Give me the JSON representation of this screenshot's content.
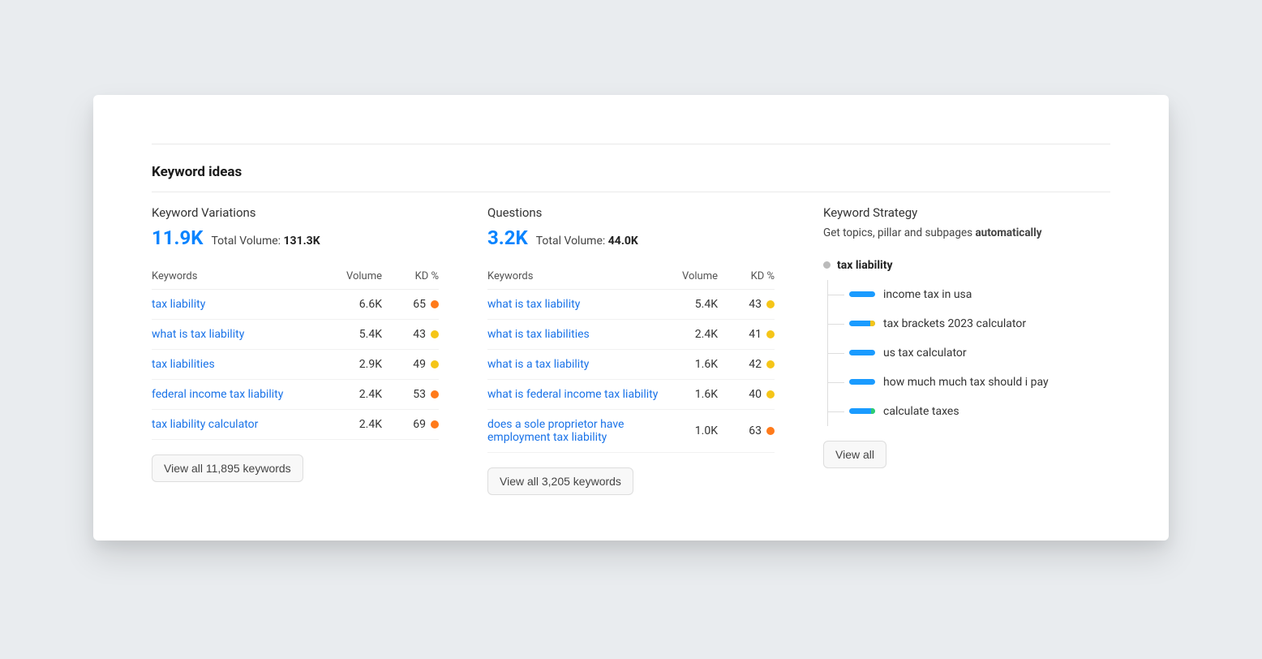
{
  "title": "Keyword ideas",
  "variations": {
    "heading": "Keyword Variations",
    "metric": "11.9K",
    "total_label": "Total Volume:",
    "total_value": "131.3K",
    "cols": {
      "keywords": "Keywords",
      "volume": "Volume",
      "kd": "KD %"
    },
    "rows": [
      {
        "kw": "tax liability",
        "vol": "6.6K",
        "kd": "65",
        "color": "orange"
      },
      {
        "kw": "what is tax liability",
        "vol": "5.4K",
        "kd": "43",
        "color": "yellow"
      },
      {
        "kw": "tax liabilities",
        "vol": "2.9K",
        "kd": "49",
        "color": "yellow"
      },
      {
        "kw": "federal income tax liability",
        "vol": "2.4K",
        "kd": "53",
        "color": "orange"
      },
      {
        "kw": "tax liability calculator",
        "vol": "2.4K",
        "kd": "69",
        "color": "orange"
      }
    ],
    "button": "View all 11,895 keywords"
  },
  "questions": {
    "heading": "Questions",
    "metric": "3.2K",
    "total_label": "Total Volume:",
    "total_value": "44.0K",
    "cols": {
      "keywords": "Keywords",
      "volume": "Volume",
      "kd": "KD %"
    },
    "rows": [
      {
        "kw": "what is tax liability",
        "vol": "5.4K",
        "kd": "43",
        "color": "yellow"
      },
      {
        "kw": "what is tax liabilities",
        "vol": "2.4K",
        "kd": "41",
        "color": "yellow"
      },
      {
        "kw": "what is a tax liability",
        "vol": "1.6K",
        "kd": "42",
        "color": "yellow"
      },
      {
        "kw": "what is federal income tax liability",
        "vol": "1.6K",
        "kd": "40",
        "color": "yellow"
      },
      {
        "kw": "does a sole proprietor have employment tax liability",
        "vol": "1.0K",
        "kd": "63",
        "color": "orange"
      }
    ],
    "button": "View all 3,205 keywords"
  },
  "strategy": {
    "heading": "Keyword Strategy",
    "desc_prefix": "Get topics, pillar and subpages ",
    "desc_bold": "automatically",
    "root": "tax liability",
    "items": [
      {
        "label": "income tax in usa",
        "accent": "none"
      },
      {
        "label": "tax brackets 2023 calculator",
        "accent": "yellow"
      },
      {
        "label": "us tax calculator",
        "accent": "none"
      },
      {
        "label": "how much much tax should i pay",
        "accent": "none"
      },
      {
        "label": "calculate taxes",
        "accent": "green"
      }
    ],
    "button": "View all"
  }
}
